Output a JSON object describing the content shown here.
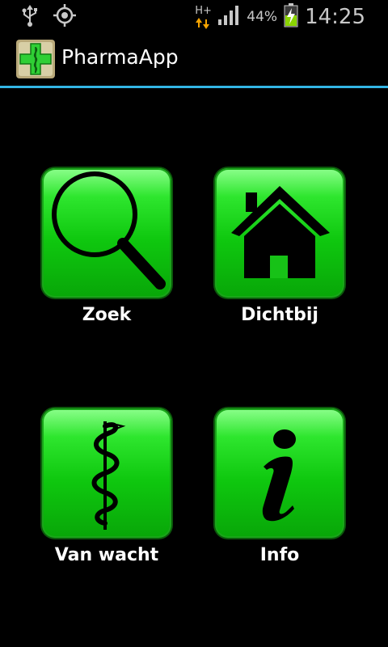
{
  "status_bar": {
    "network": "H+",
    "battery": "44%",
    "time": "14:25",
    "icons": [
      "usb-icon",
      "gps-icon",
      "network-h-plus-icon",
      "signal-icon",
      "battery-charging-icon"
    ]
  },
  "action_bar": {
    "title": "PharmaApp",
    "icon": "pharmacy-cross-icon"
  },
  "menu": {
    "items": [
      {
        "label": "Zoek",
        "icon": "magnifier-icon"
      },
      {
        "label": "Dichtbij",
        "icon": "house-icon"
      },
      {
        "label": "Van wacht",
        "icon": "rod-of-asclepius-icon"
      },
      {
        "label": "Info",
        "icon": "info-icon"
      }
    ]
  },
  "colors": {
    "background": "#000000",
    "tile_green": "#0fc80f",
    "divider": "#33b5e5",
    "text": "#ffffff"
  }
}
